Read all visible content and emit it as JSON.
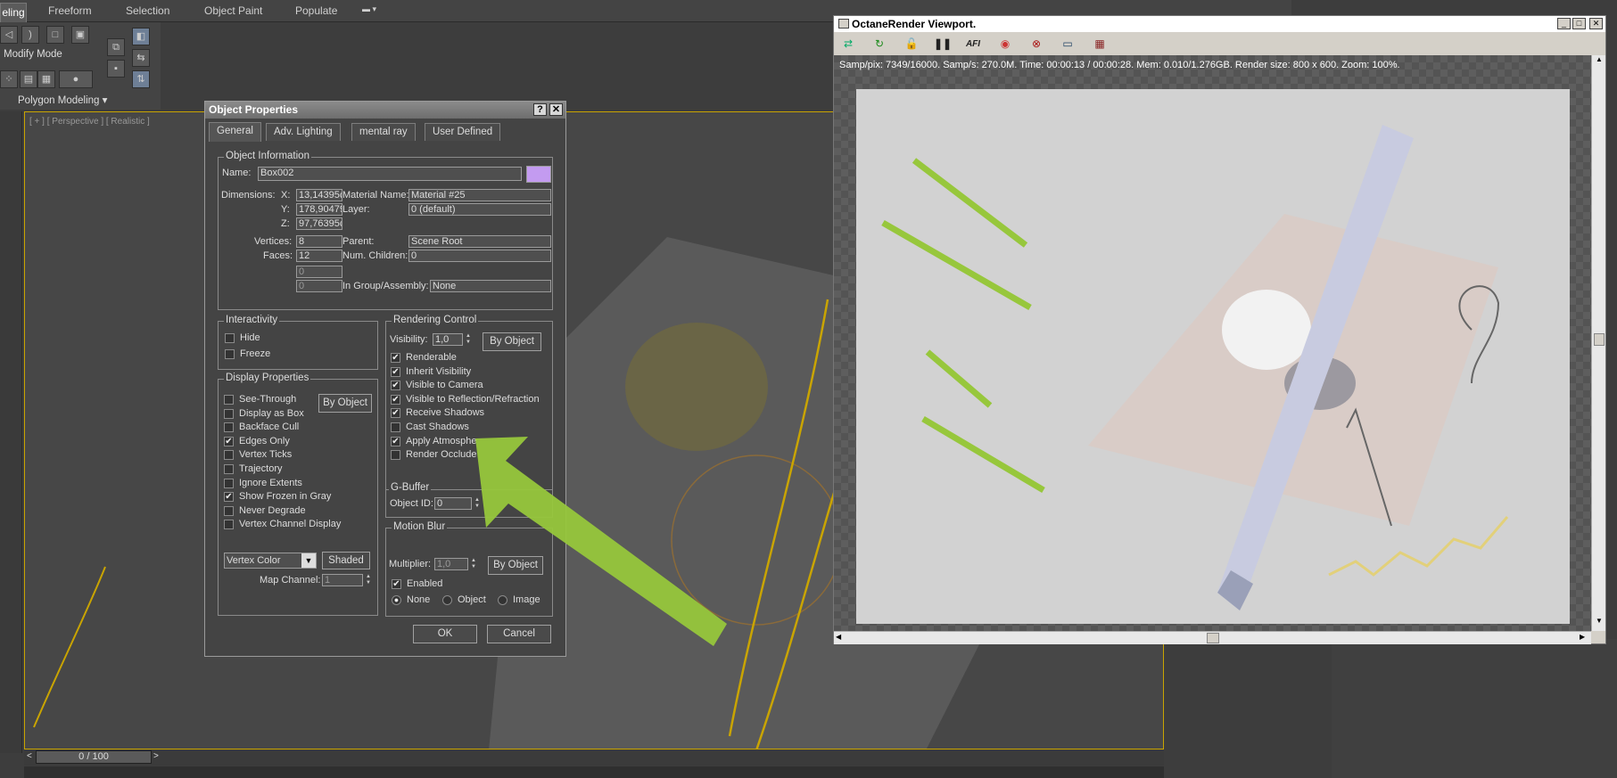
{
  "ribbon": {
    "tabs": [
      "eling",
      "Freeform",
      "Selection",
      "Object Paint",
      "Populate"
    ],
    "modify_mode": "Modify Mode",
    "polygon_modeling": "Polygon Modeling"
  },
  "viewport": {
    "label": "[ + ] [ Perspective ] [ Realistic ]"
  },
  "timeline": {
    "slider": "0 / 100"
  },
  "dialog": {
    "title": "Object Properties",
    "help": "?",
    "close": "✕",
    "tabs": [
      "General",
      "Adv. Lighting",
      "mental ray",
      "User Defined"
    ],
    "object_info": {
      "group": "Object Information",
      "name_label": "Name:",
      "name_value": "Box002",
      "color": "#c39bf0",
      "dimensions_label": "Dimensions:",
      "x_label": "X:",
      "x_value": "13,14395c",
      "y_label": "Y:",
      "y_value": "178,90479",
      "z_label": "Z:",
      "z_value": "97,76395c",
      "vertices_label": "Vertices:",
      "vertices_value": "8",
      "faces_label": "Faces:",
      "faces_value": "12",
      "extra1": "0",
      "extra2": "0",
      "material_label": "Material Name:",
      "material_value": "Material #25",
      "layer_label": "Layer:",
      "layer_value": "0 (default)",
      "parent_label": "Parent:",
      "parent_value": "Scene Root",
      "children_label": "Num. Children:",
      "children_value": "0",
      "group_label": "In Group/Assembly:",
      "group_value": "None"
    },
    "interactivity": {
      "group": "Interactivity",
      "hide": "Hide",
      "freeze": "Freeze"
    },
    "display": {
      "group": "Display Properties",
      "by_object": "By Object",
      "items": [
        {
          "label": "See-Through",
          "checked": ""
        },
        {
          "label": "Display as Box",
          "checked": ""
        },
        {
          "label": "Backface Cull",
          "checked": ""
        },
        {
          "label": "Edges Only",
          "checked": "✔"
        },
        {
          "label": "Vertex Ticks",
          "checked": ""
        },
        {
          "label": "Trajectory",
          "checked": ""
        },
        {
          "label": "Ignore Extents",
          "checked": ""
        },
        {
          "label": "Show Frozen in Gray",
          "checked": "✔"
        },
        {
          "label": "Never Degrade",
          "checked": ""
        },
        {
          "label": "Vertex Channel Display",
          "checked": ""
        }
      ],
      "vertex_color": "Vertex Color",
      "shaded": "Shaded",
      "map_channel_label": "Map Channel:",
      "map_channel_value": "1"
    },
    "rendering": {
      "group": "Rendering Control",
      "visibility_label": "Visibility:",
      "visibility_value": "1,0",
      "by_object": "By Object",
      "items": [
        {
          "label": "Renderable",
          "checked": "✔"
        },
        {
          "label": "Inherit Visibility",
          "checked": "✔"
        },
        {
          "label": "Visible to Camera",
          "checked": "✔"
        },
        {
          "label": "Visible to Reflection/Refraction",
          "checked": "✔"
        },
        {
          "label": "Receive Shadows",
          "checked": "✔"
        },
        {
          "label": "Cast Shadows",
          "checked": ""
        },
        {
          "label": "Apply Atmosphe",
          "checked": "✔"
        },
        {
          "label": "Render Occlude",
          "checked": ""
        }
      ]
    },
    "gbuffer": {
      "group": "G-Buffer",
      "label": "Object ID:",
      "value": "0"
    },
    "motion_blur": {
      "group": "Motion Blur",
      "multiplier_label": "Multiplier:",
      "multiplier_value": "1,0",
      "by_object": "By Object",
      "enabled": "Enabled",
      "none": "None",
      "object": "Object",
      "image": "Image"
    },
    "ok": "OK",
    "cancel": "Cancel"
  },
  "octane": {
    "title": "OctaneRender Viewport.",
    "stats": "Samp/pix: 7349/16000.   Samp/s: 270.0M.   Time: 00:00:13 / 00:00:28.   Mem: 0.010/1.276GB.   Render size: 800 x 600.   Zoom: 100%.",
    "toolbar_afi": "AFI"
  }
}
